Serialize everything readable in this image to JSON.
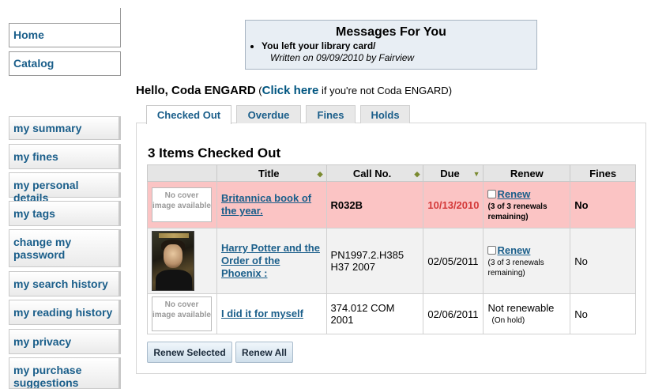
{
  "nav": {
    "home": "Home",
    "catalog": "Catalog"
  },
  "sidebar": {
    "items": [
      {
        "label": "my summary"
      },
      {
        "label": "my fines"
      },
      {
        "label": "my personal details"
      },
      {
        "label": "my tags"
      },
      {
        "label": "change my password"
      },
      {
        "label": "my search history"
      },
      {
        "label": "my reading history"
      },
      {
        "label": "my privacy"
      },
      {
        "label": "my purchase suggestions"
      }
    ]
  },
  "messages": {
    "title": "Messages For You",
    "items": [
      {
        "text": "You left your library card/",
        "written": "Written on 09/09/2010 by Fairview"
      }
    ]
  },
  "greeting": {
    "hello": "Hello, Coda ENGARD",
    "open_paren": " (",
    "link": "Click here",
    "tail": " if you're not Coda ENGARD)"
  },
  "tabs": [
    "Checked Out",
    "Overdue",
    "Fines",
    "Holds"
  ],
  "checked_out": {
    "heading": "3 Items Checked Out",
    "columns": [
      "Title",
      "Call No.",
      "Due",
      "Renew",
      "Fines"
    ],
    "no_cover_text": "No cover image available",
    "rows": [
      {
        "title": "Britannica book of the year.",
        "call_no": "R032B",
        "due": "10/13/2010",
        "renew": "Renew",
        "renew_note": "(3 of 3 renewals remaining)",
        "fines": "No"
      },
      {
        "title": "Harry Potter and the Order of the Phoenix :",
        "call_no": "PN1997.2.H385 H37 2007",
        "due": "02/05/2011",
        "renew": "Renew",
        "renew_note": "(3 of 3 renewals remaining)",
        "fines": "No"
      },
      {
        "title": "I did it for myself",
        "call_no": "374.012 COM 2001",
        "due": "02/06/2011",
        "renew": "Not renewable",
        "renew_note": "(On hold)",
        "fines": "No"
      }
    ]
  },
  "buttons": {
    "renew_selected": "Renew Selected",
    "renew_all": "Renew All"
  }
}
